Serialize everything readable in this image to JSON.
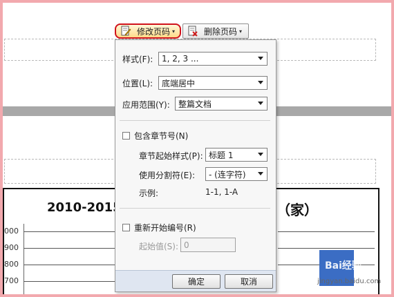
{
  "toolbar": {
    "modify_label": "修改页码",
    "delete_label": "删除页码"
  },
  "dialog": {
    "style_label": "样式(F):",
    "style_value": "1, 2, 3 ...",
    "position_label": "位置(L):",
    "position_value": "底端居中",
    "scope_label": "应用范围(Y):",
    "scope_value": "整篇文档",
    "include_chapter_label": "包含章节号(N)",
    "include_chapter_checked": false,
    "chapter_start_label": "章节起始样式(P):",
    "chapter_start_value": "标题 1",
    "separator_label": "使用分割符(E):",
    "separator_value": "-    (连字符)",
    "example_label": "示例:",
    "example_value": "1-1, 1-A",
    "restart_label": "重新开始编号(R)",
    "restart_checked": false,
    "start_value_label": "起始值(S):",
    "start_value": "0",
    "ok_label": "确定",
    "cancel_label": "取消"
  },
  "document": {
    "chart_title_left": "2010-2015",
    "chart_title_right": "（家）",
    "y_ticks": [
      "000",
      "900",
      "800",
      "700"
    ]
  },
  "watermark": {
    "logo_text": "Bai",
    "logo_suffix": "经验",
    "url": "jingyan.baidu.com"
  },
  "colors": {
    "page_border": "#f2a9ae",
    "highlight_ring": "#d0121b",
    "dialog_footer": "#dfe6f1"
  }
}
